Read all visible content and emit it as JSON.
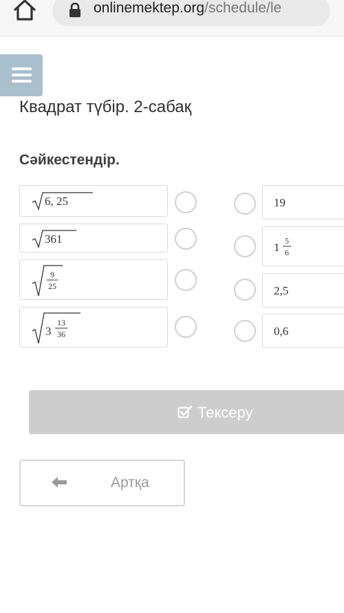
{
  "browser": {
    "url_domain": "onlinemektep.org",
    "url_path": "/schedule/le"
  },
  "page": {
    "title": "Квадрат түбір. 2-сабақ",
    "instruction": "Сәйкестендір."
  },
  "left_items": [
    {
      "expr": "√6,25"
    },
    {
      "expr": "√361"
    },
    {
      "expr": "√(9/25)"
    },
    {
      "expr": "√(3 13/36)"
    }
  ],
  "right_items": [
    {
      "whole": "19",
      "num": "",
      "den": ""
    },
    {
      "whole": "1",
      "num": "5",
      "den": "6"
    },
    {
      "whole": "2,5",
      "num": "",
      "den": ""
    },
    {
      "whole": "0,6",
      "num": "",
      "den": ""
    }
  ],
  "math": {
    "l1": "6, 25",
    "l2": "361",
    "l3_num": "9",
    "l3_den": "25",
    "l4_whole": "3",
    "l4_num": "13",
    "l4_den": "36"
  },
  "buttons": {
    "check_label": "Тексеру",
    "back_label": "Артқа"
  },
  "icons": {
    "home": "home-icon",
    "lock": "lock-icon",
    "menu": "hamburger-menu-icon",
    "check": "checkbox-check-icon",
    "back": "arrow-left-icon"
  },
  "colors": {
    "menu_bg": "#a8bfcd",
    "check_btn_bg": "#cdcdcd",
    "radio_border": "#d0d0d0"
  }
}
